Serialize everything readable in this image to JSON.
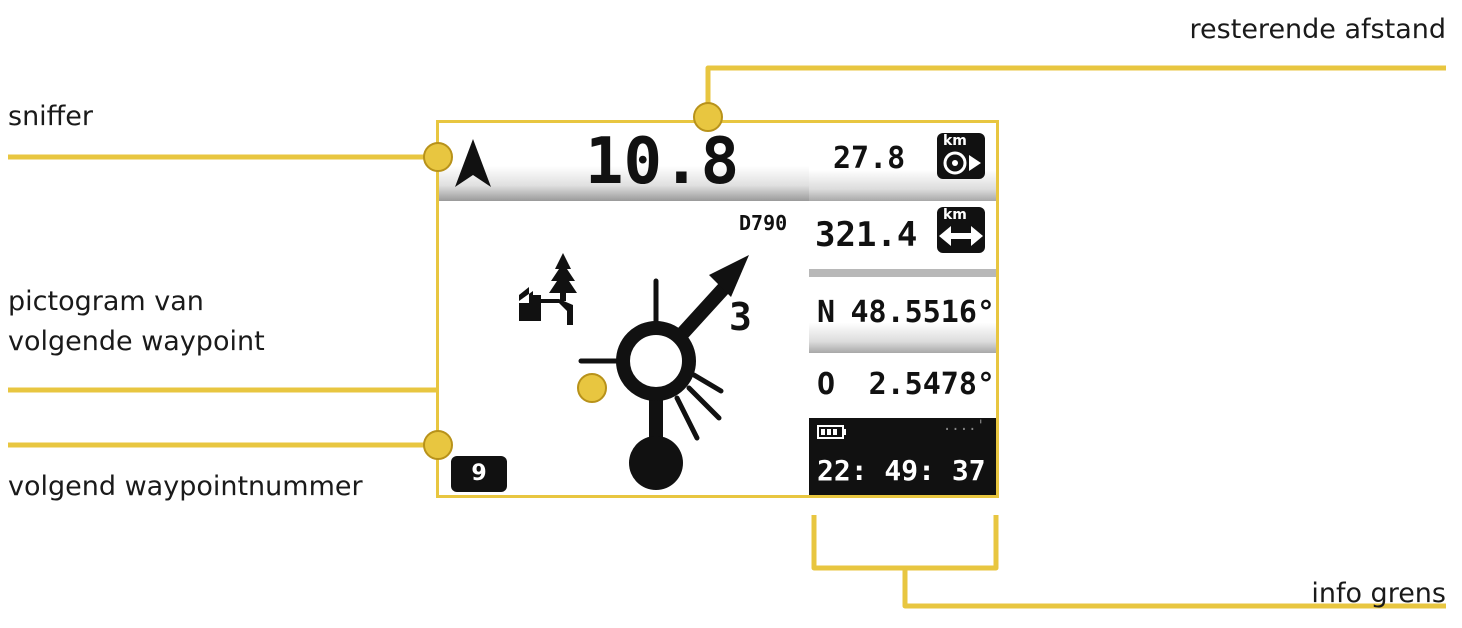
{
  "annotations": {
    "remaining_distance": "resterende afstand",
    "sniffer": "sniffer",
    "pictogram_line1": "pictogram van",
    "pictogram_line2": "volgende waypoint",
    "next_waypoint_number": "volgend waypointnummer",
    "info_border": "info grens"
  },
  "device": {
    "distance_main": "10.8",
    "trip_distance": "27.8",
    "trip_unit": "km",
    "total_distance": "321.4",
    "total_unit": "km",
    "road_code": "D790",
    "exit_number": "3",
    "lat_prefix": "N",
    "lat_value": "48.5516°",
    "lon_prefix": "O",
    "lon_value": "2.5478°",
    "clock": "22: 49: 37",
    "signal_dots": "....'",
    "waypoint_number": "9"
  },
  "colors": {
    "callout": "#e8c640",
    "callout_dark": "#c9a52a",
    "screen_text": "#111111"
  },
  "icons": [
    "sniffer-arrow-icon",
    "roundabout-icon",
    "landmark-pictogram-icon",
    "odometer-icon",
    "double-arrow-icon",
    "battery-icon"
  ]
}
